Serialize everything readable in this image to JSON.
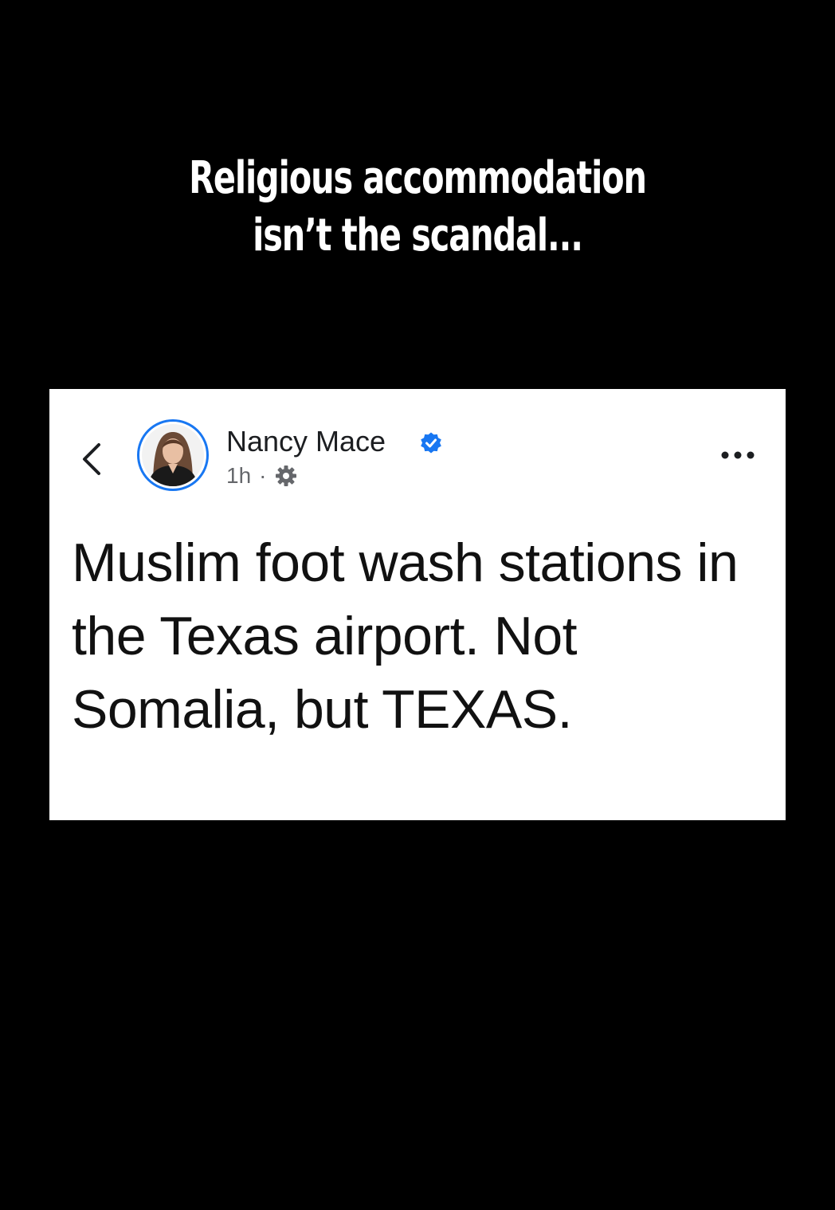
{
  "overlay": {
    "headline_line1": "Religious accommodation",
    "headline_line2": "isn’t the scandal..."
  },
  "post": {
    "author_name": "Nancy Mace",
    "verified": true,
    "timestamp": "1h",
    "meta_separator": "·",
    "audience_icon": "gear-icon",
    "text": "Muslim foot wash stations in the Texas airport. Not Somalia, but TEXAS."
  },
  "icons": {
    "back": "chevron-left-icon",
    "more": "more-horizontal-icon",
    "verified": "verified-badge-icon"
  },
  "colors": {
    "background": "#000000",
    "card": "#ffffff",
    "accent": "#1877f2",
    "meta_text": "#65676b"
  }
}
